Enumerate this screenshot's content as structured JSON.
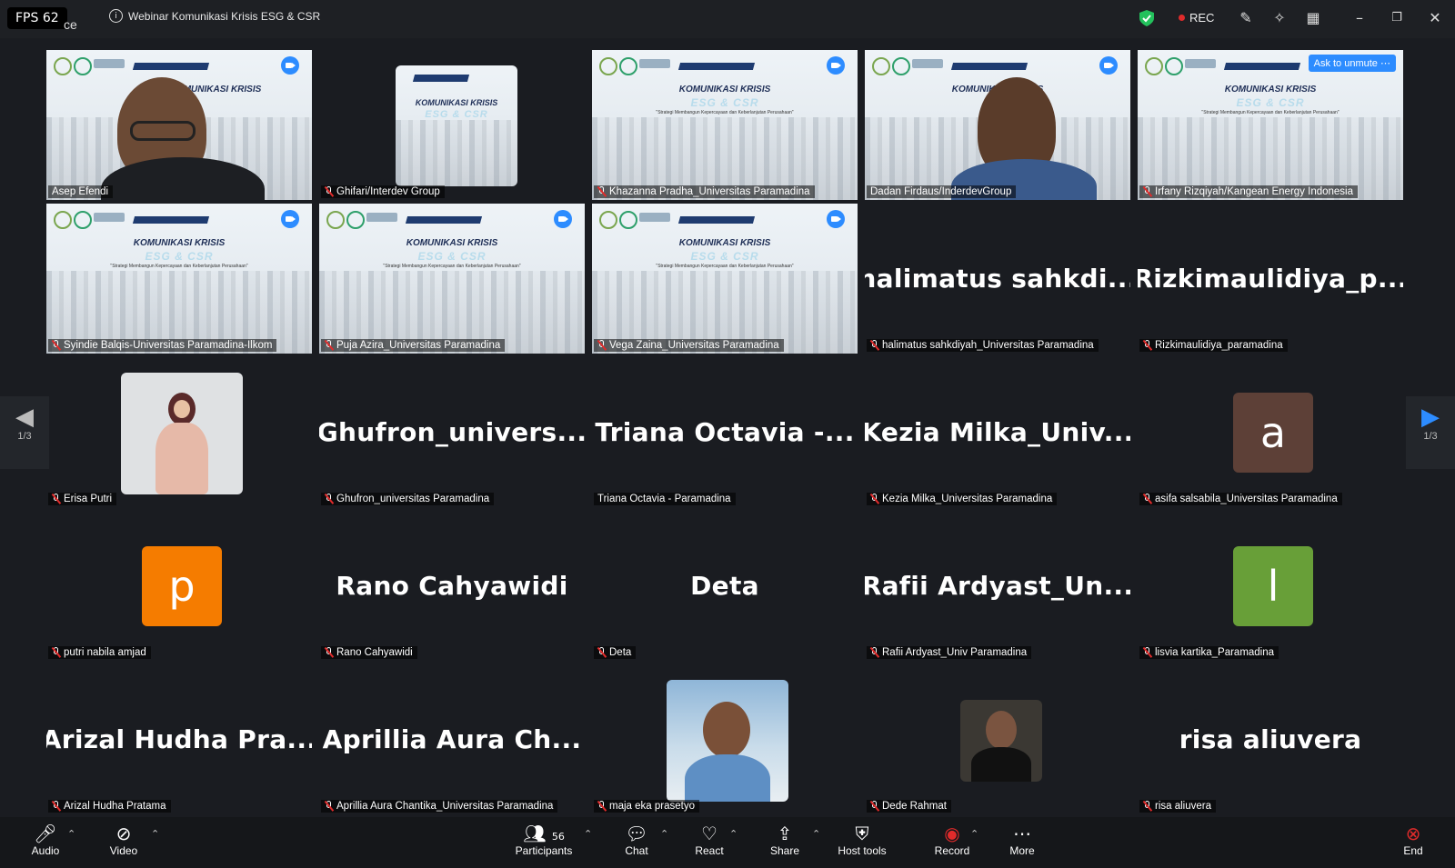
{
  "titlebar": {
    "fps": "FPS 62",
    "fps_tail": "ce",
    "meeting_title": "Webinar Komunikasi Krisis ESG & CSR",
    "rec": "REC"
  },
  "slide": {
    "title1": "KOMUNIKASI KRISIS",
    "title2": "ESG & CSR",
    "subtitle": "\"Strategi Membangun Kepercayaan dan Keberlanjutan Perusahaan\"",
    "brand": "paramadina"
  },
  "tiles": [
    {
      "name": "Asep Efendi"
    },
    {
      "name": "Ghifari/Interdev Group"
    },
    {
      "name": "Khazanna Pradha_Universitas Paramadina"
    },
    {
      "name": "Dadan Firdaus/InderdevGroup"
    },
    {
      "name": "Irfany Rizqiyah/Kangean Energy Indonesia",
      "ask": "Ask to unmute"
    },
    {
      "name": "Syindie Balqis-Universitas Paramadina-Ilkom"
    },
    {
      "name": "Puja Azira_Universitas Paramadina"
    },
    {
      "name": "Vega Zaina_Universitas Paramadina"
    },
    {
      "name": "halimatus sahkdiyah_Universitas Paramadina",
      "big": "halimatus  sahkdi..."
    },
    {
      "name": "Rizkimaulidiya_paramadina",
      "big": "Rizkimaulidiya_p..."
    },
    {
      "name": "Erisa Putri"
    },
    {
      "name": "Ghufron_universitas Paramadina",
      "big": "Ghufron_univers..."
    },
    {
      "name": "Triana Octavia - Paramadina",
      "big": "Triana  Octavia  -..."
    },
    {
      "name": "Kezia Milka_Universitas Paramadina",
      "big": "Kezia  Milka_Univ..."
    },
    {
      "name": "asifa salsabila_Universitas Paramadina",
      "letter": "a"
    },
    {
      "name": "putri nabila amjad",
      "letter": "p"
    },
    {
      "name": "Rano Cahyawidi",
      "big": "Rano Cahyawidi"
    },
    {
      "name": "Deta",
      "big": "Deta"
    },
    {
      "name": "Rafii Ardyast_Univ Paramadina",
      "big": "Rafii  Ardyast_Un..."
    },
    {
      "name": "lisvia kartika_Paramadina",
      "letter": "l"
    },
    {
      "name": "Arizal Hudha Pratama",
      "big": "Arizal  Hudha  Pra..."
    },
    {
      "name": "Aprillia Aura Chantika_Universitas Paramadina",
      "big": "Aprillia  Aura  Ch..."
    },
    {
      "name": "maja eka prasetyo"
    },
    {
      "name": "Dede Rahmat"
    },
    {
      "name": "risa aliuvera",
      "big": "risa aliuvera"
    }
  ],
  "nav": {
    "page_left": "1/3",
    "page_right": "1/3"
  },
  "toolbar": {
    "audio": "Audio",
    "video": "Video",
    "participants": "Participants",
    "participants_count": "56",
    "chat": "Chat",
    "react": "React",
    "share": "Share",
    "host_tools": "Host tools",
    "record": "Record",
    "more": "More",
    "end": "End"
  },
  "colors": {
    "accent": "#2d8cff",
    "active_speaker": "#23d18b",
    "record": "#e02b2b",
    "avatar_a": "#5d4037",
    "avatar_p": "#f57c00",
    "avatar_l": "#689f38"
  }
}
